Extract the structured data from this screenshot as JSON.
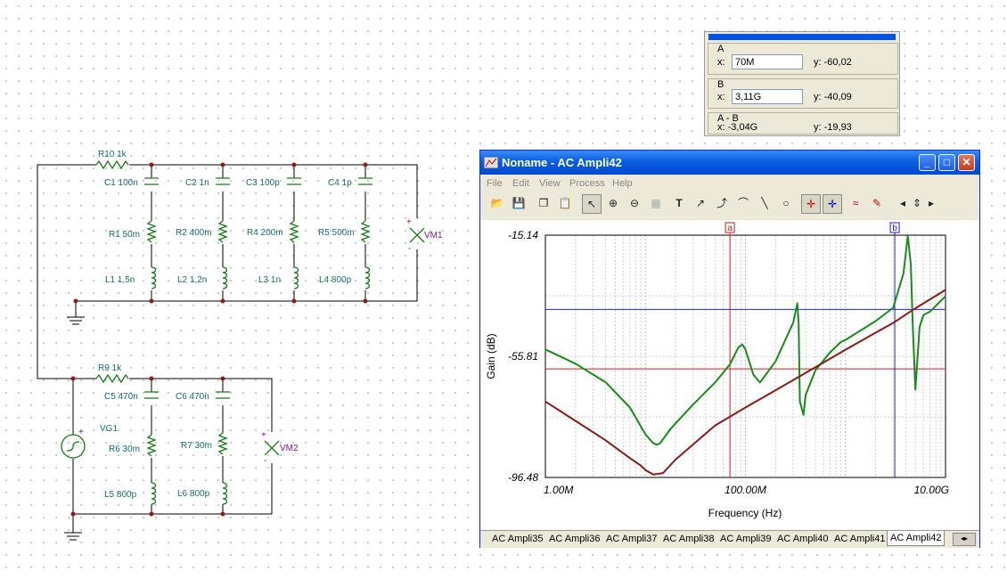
{
  "schematic": {
    "components": {
      "R10": "R10 1k",
      "C1": "C1 100n",
      "C2": "C2 1n",
      "C3": "C3 100p",
      "C4": "C4 1p",
      "R1": "R1 50m",
      "R2": "R2 400m",
      "R4": "R4 200m",
      "R5": "R5 500m",
      "L1": "L1 1,5n",
      "L2": "L2 1,2n",
      "L3": "L3 1n",
      "L4": "L4 800p",
      "VM1": "VM1",
      "R9": "R9 1k",
      "C5": "C5 470n",
      "C6": "C6 470n",
      "VG1": "VG1",
      "R6": "R6 30m",
      "R7": "R7 30m",
      "L5": "L5 800p",
      "L6": "L6 800p",
      "VM2": "VM2"
    },
    "meter_plus": "+",
    "meter_minus": "-"
  },
  "cursor_panel": {
    "a": {
      "label": "A",
      "x_label": "x:",
      "x": "70M",
      "y": "y: -60,02"
    },
    "b": {
      "label": "B",
      "x_label": "x:",
      "x": "3,11G",
      "y": "y: -40,09"
    },
    "ab": {
      "label": "A - B",
      "x": "x: -3,04G",
      "y": "y: -19,93"
    }
  },
  "window": {
    "title": "Noname - AC Ampli42",
    "menu": [
      "File",
      "Edit",
      "View",
      "Process",
      "Help"
    ],
    "tabs": [
      "AC Ampli35",
      "AC Ampli36",
      "AC Ampli37",
      "AC Ampli38",
      "AC Ampli39",
      "AC Ampli40",
      "AC Ampli41",
      "AC Ampli42"
    ],
    "active_tab": "AC Ampli42",
    "toolbar_icons": [
      "open-folder-icon",
      "save-icon",
      "copy-icon",
      "paste-icon",
      "pointer-icon",
      "zoom-in-icon",
      "zoom-out-icon",
      "zoom-100-icon",
      "grid-icon",
      "text-icon",
      "curve-label-icon",
      "curve-label2-icon",
      "curve-label3-icon",
      "line-icon",
      "ellipse-icon",
      "cursor-a-icon",
      "cursor-b-icon",
      "add-curve-icon",
      "probe-icon",
      "nav-left-icon",
      "nav-updown-icon",
      "nav-right-icon"
    ]
  },
  "chart_data": {
    "type": "line",
    "xlabel": "Frequency (Hz)",
    "ylabel": "Gain (dB)",
    "x_scale": "log",
    "xlim": [
      1000000,
      10000000000
    ],
    "ylim": [
      -96.48,
      -15.14
    ],
    "x_ticks": [
      "1.00M",
      "100.00M",
      "10.00G"
    ],
    "y_ticks": [
      "-15.14",
      "-55.81",
      "-96.48"
    ],
    "cursor_a": {
      "label": "a",
      "x": 70000000,
      "y": -60.02
    },
    "cursor_b": {
      "label": "b",
      "x": 3110000000,
      "y": -40.09
    },
    "series": [
      {
        "color": "#1a8a1a",
        "x": [
          1000000,
          2000000,
          4000000,
          7000000,
          10000000,
          12000000,
          13000000,
          14000000,
          18000000,
          30000000,
          50000000,
          70000000,
          85000000,
          93000000,
          100000000,
          120000000,
          140000000,
          200000000,
          300000000,
          330000000,
          340000000,
          350000000,
          380000000,
          400000000,
          500000000,
          700000000,
          900000000,
          1000000000,
          2000000000,
          3000000000,
          3800000000,
          4200000000,
          4500000000,
          4700000000,
          5000000000,
          5500000000,
          6000000000,
          7000000000,
          10000000000
        ],
        "y": [
          -53.5,
          -58.3,
          -64.5,
          -73,
          -82,
          -85,
          -85.5,
          -85,
          -80,
          -72,
          -64.5,
          -58.5,
          -52.8,
          -51.8,
          -53.5,
          -62,
          -64.6,
          -57.5,
          -44.5,
          -38,
          -45,
          -71,
          -75.5,
          -68.8,
          -60.5,
          -54.5,
          -51,
          -50.3,
          -44,
          -39.5,
          -28,
          -15.4,
          -25,
          -45,
          -67,
          -46,
          -42,
          -40.8,
          -35.6
        ]
      },
      {
        "color": "#8b1a1a",
        "x": [
          1000000,
          2000000,
          4000000,
          7000000,
          9000000,
          10000000,
          12000000,
          15000000,
          20000000,
          50000000,
          100000000,
          200000000,
          500000000,
          1000000000,
          2000000000,
          3000000000,
          5000000000,
          10000000000
        ],
        "y": [
          -71,
          -77.5,
          -84,
          -90,
          -92.5,
          -94,
          -95.5,
          -95,
          -90.5,
          -79,
          -73,
          -67.2,
          -59.5,
          -53.6,
          -47.9,
          -44.6,
          -39.7,
          -33.5
        ]
      }
    ]
  }
}
